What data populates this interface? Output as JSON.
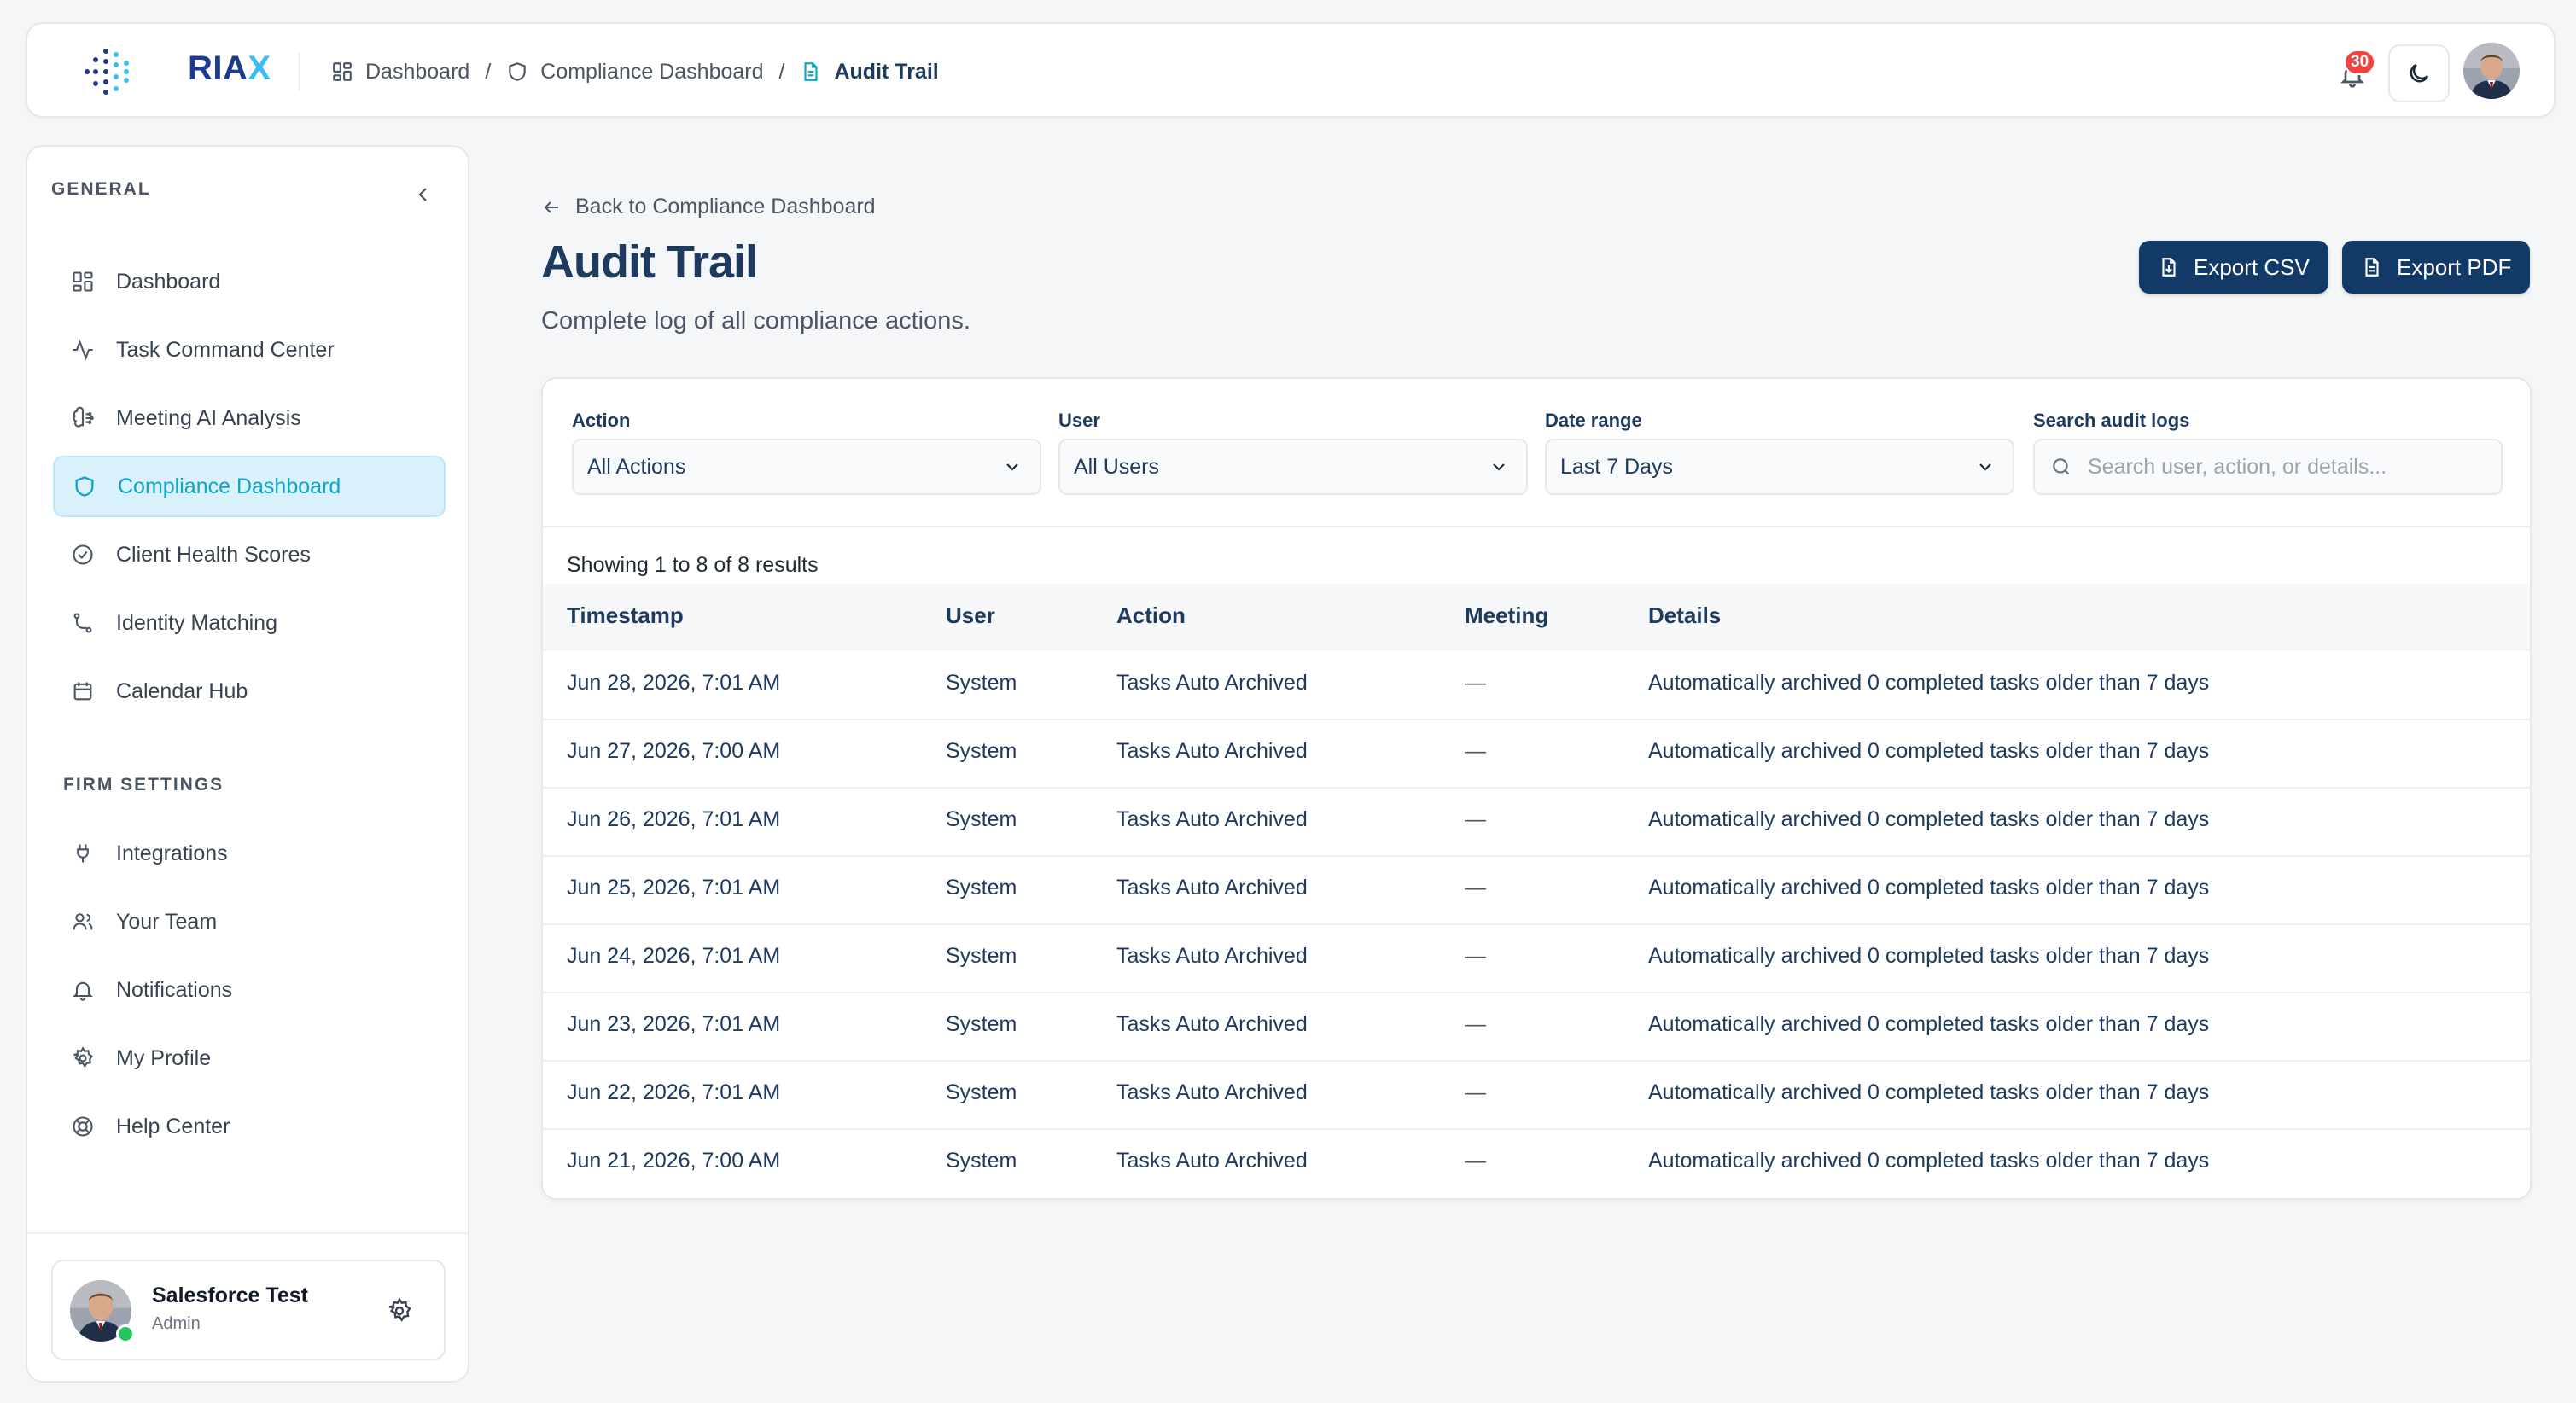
{
  "brand": {
    "name_main": "RIA",
    "name_accent": "X"
  },
  "breadcrumb": [
    {
      "label": "Dashboard",
      "icon": "grid-icon"
    },
    {
      "label": "Compliance Dashboard",
      "icon": "shield-icon"
    },
    {
      "label": "Audit Trail",
      "icon": "file-icon"
    }
  ],
  "header": {
    "notification_count": "30"
  },
  "sidebar": {
    "general_heading": "GENERAL",
    "general_items": [
      {
        "label": "Dashboard",
        "icon": "grid-icon"
      },
      {
        "label": "Task Command Center",
        "icon": "activity-icon"
      },
      {
        "label": "Meeting AI Analysis",
        "icon": "brain-icon"
      },
      {
        "label": "Compliance Dashboard",
        "icon": "shield-icon",
        "active": true
      },
      {
        "label": "Client Health Scores",
        "icon": "check-circle-icon"
      },
      {
        "label": "Identity Matching",
        "icon": "git-branch-icon"
      },
      {
        "label": "Calendar Hub",
        "icon": "calendar-icon"
      }
    ],
    "firm_heading": "FIRM SETTINGS",
    "firm_items": [
      {
        "label": "Integrations",
        "icon": "plug-icon"
      },
      {
        "label": "Your Team",
        "icon": "users-icon"
      },
      {
        "label": "Notifications",
        "icon": "bell-icon"
      },
      {
        "label": "My Profile",
        "icon": "settings-icon"
      },
      {
        "label": "Help Center",
        "icon": "life-buoy-icon"
      }
    ],
    "user": {
      "name": "Salesforce Test",
      "role": "Admin"
    }
  },
  "page": {
    "back_label": "Back to Compliance Dashboard",
    "title": "Audit Trail",
    "subtitle": "Complete log of all compliance actions.",
    "export_csv": "Export CSV",
    "export_pdf": "Export PDF"
  },
  "filters": {
    "action_label": "Action",
    "action_value": "All Actions",
    "user_label": "User",
    "user_value": "All Users",
    "date_label": "Date range",
    "date_value": "Last 7 Days",
    "search_label": "Search audit logs",
    "search_placeholder": "Search user, action, or details..."
  },
  "table": {
    "results_text": "Showing 1 to 8 of 8 results",
    "columns": [
      "Timestamp",
      "User",
      "Action",
      "Meeting",
      "Details"
    ],
    "rows": [
      {
        "timestamp": "Jun 28, 2026, 7:01 AM",
        "user": "System",
        "action": "Tasks Auto Archived",
        "meeting": "—",
        "details": "Automatically archived 0 completed tasks older than 7 days"
      },
      {
        "timestamp": "Jun 27, 2026, 7:00 AM",
        "user": "System",
        "action": "Tasks Auto Archived",
        "meeting": "—",
        "details": "Automatically archived 0 completed tasks older than 7 days"
      },
      {
        "timestamp": "Jun 26, 2026, 7:01 AM",
        "user": "System",
        "action": "Tasks Auto Archived",
        "meeting": "—",
        "details": "Automatically archived 0 completed tasks older than 7 days"
      },
      {
        "timestamp": "Jun 25, 2026, 7:01 AM",
        "user": "System",
        "action": "Tasks Auto Archived",
        "meeting": "—",
        "details": "Automatically archived 0 completed tasks older than 7 days"
      },
      {
        "timestamp": "Jun 24, 2026, 7:01 AM",
        "user": "System",
        "action": "Tasks Auto Archived",
        "meeting": "—",
        "details": "Automatically archived 0 completed tasks older than 7 days"
      },
      {
        "timestamp": "Jun 23, 2026, 7:01 AM",
        "user": "System",
        "action": "Tasks Auto Archived",
        "meeting": "—",
        "details": "Automatically archived 0 completed tasks older than 7 days"
      },
      {
        "timestamp": "Jun 22, 2026, 7:01 AM",
        "user": "System",
        "action": "Tasks Auto Archived",
        "meeting": "—",
        "details": "Automatically archived 0 completed tasks older than 7 days"
      },
      {
        "timestamp": "Jun 21, 2026, 7:00 AM",
        "user": "System",
        "action": "Tasks Auto Archived",
        "meeting": "—",
        "details": "Automatically archived 0 completed tasks older than 7 days"
      }
    ]
  },
  "colors": {
    "accent": "#0ea5c6",
    "primary": "#133a66",
    "badge": "#ef4444",
    "online": "#22c55e"
  }
}
